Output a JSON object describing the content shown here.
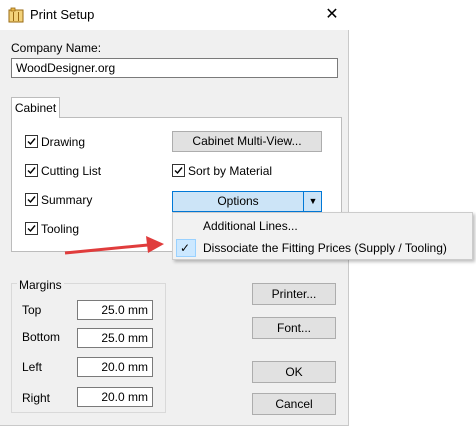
{
  "window": {
    "title": "Print Setup",
    "close_icon": "close-icon",
    "app_icon": "cabinet-icon"
  },
  "company": {
    "label": "Company Name:",
    "value": "WoodDesigner.org"
  },
  "tab": {
    "label": "Cabinet"
  },
  "checkboxes": {
    "drawing": {
      "label": "Drawing",
      "checked": true
    },
    "cutting_list": {
      "label": "Cutting List",
      "checked": true
    },
    "summary": {
      "label": "Summary",
      "checked": true
    },
    "tooling": {
      "label": "Tooling",
      "checked": true
    },
    "sort_by_material": {
      "label": "Sort by Material",
      "checked": true
    }
  },
  "buttons": {
    "cabinet_multiview": "Cabinet Multi-View...",
    "options": "Options",
    "printer": "Printer...",
    "font": "Font...",
    "ok": "OK",
    "cancel": "Cancel"
  },
  "options_menu": {
    "items": [
      {
        "label": "Additional Lines...",
        "checked": false
      },
      {
        "label": "Dissociate the Fitting Prices (Supply / Tooling)",
        "checked": true
      }
    ]
  },
  "margins": {
    "title": "Margins",
    "top": {
      "label": "Top",
      "value": "25.0 mm"
    },
    "bottom": {
      "label": "Bottom",
      "value": "25.0 mm"
    },
    "left": {
      "label": "Left",
      "value": "20.0 mm"
    },
    "right": {
      "label": "Right",
      "value": "20.0 mm"
    }
  },
  "colors": {
    "accent": "#0078d7",
    "highlight": "#cce4f7",
    "arrow": "#e03c3c"
  }
}
